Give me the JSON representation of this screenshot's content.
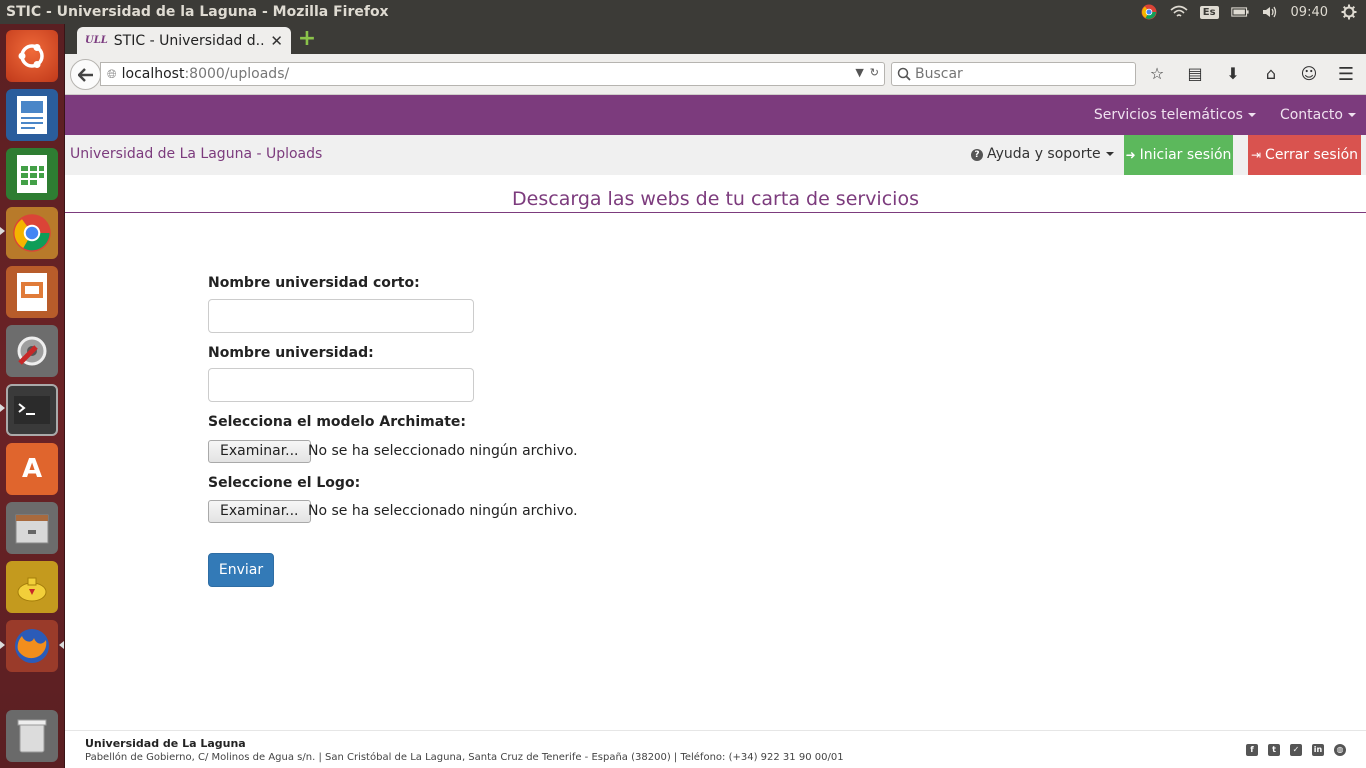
{
  "system": {
    "window_title": "STIC - Universidad de la Laguna - Mozilla Firefox",
    "keyboard_layout": "Es",
    "clock": "09:40"
  },
  "launcher": {
    "items": [
      "ubuntu-dash",
      "libreoffice-writer",
      "libreoffice-calc",
      "chrome",
      "libreoffice-impress",
      "system-settings",
      "terminal",
      "software-center",
      "file-manager",
      "aladdin-lamp",
      "firefox",
      "trash"
    ]
  },
  "browser": {
    "tab_title": "STIC - Universidad d...",
    "tab_favicon_text": "ULL",
    "url_host": "localhost",
    "url_path": ":8000/uploads/",
    "search_placeholder": "Buscar"
  },
  "site": {
    "topnav": [
      {
        "label": "Servicios telemáticos"
      },
      {
        "label": "Contacto"
      }
    ],
    "brand": "Universidad de La Laguna - Uploads",
    "help_label": "Ayuda y soporte",
    "login_label": "Iniciar sesión",
    "logout_label": "Cerrar sesión",
    "colors": {
      "brand": "#7c3b7d",
      "login": "#5cb85c",
      "logout": "#d9534f",
      "primary": "#337ab7"
    }
  },
  "page": {
    "heading": "Descarga las webs de tu carta de servicios",
    "fields": {
      "short_name_label": "Nombre universidad corto:",
      "short_name_value": "",
      "name_label": "Nombre universidad:",
      "name_value": "",
      "model_label": "Selecciona el modelo Archimate:",
      "logo_label": "Seleccione el Logo:"
    },
    "file_button_label": "Examinar...",
    "no_file_text": "No se ha seleccionado ningún archivo.",
    "submit_label": "Enviar"
  },
  "footer": {
    "name": "Universidad de La Laguna",
    "address": "Pabellón de Gobierno, C/ Molinos de Agua s/n. | San Cristóbal de La Laguna, Santa Cruz de Tenerife - España (38200) | Teléfono: (+34) 922 31 90 00/01",
    "social": [
      "facebook-icon",
      "tuenti-icon",
      "twitter-icon",
      "linkedin-icon",
      "web-icon"
    ]
  }
}
